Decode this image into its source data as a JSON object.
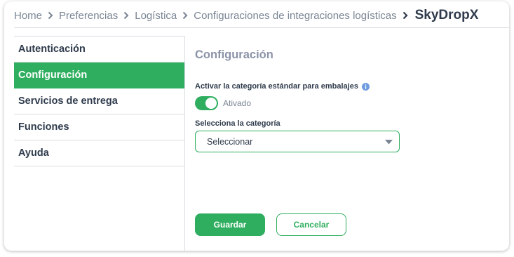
{
  "breadcrumb": {
    "items": [
      "Home",
      "Preferencias",
      "Logística",
      "Configuraciones de integraciones logísticas"
    ],
    "current": "SkyDropX"
  },
  "sidebar": {
    "items": [
      {
        "label": "Autenticación",
        "active": false
      },
      {
        "label": "Configuración",
        "active": true
      },
      {
        "label": "Servicios de entrega",
        "active": false
      },
      {
        "label": "Funciones",
        "active": false
      },
      {
        "label": "Ayuda",
        "active": false
      }
    ]
  },
  "main": {
    "title": "Configuración",
    "toggle_label": "Activar la categoría estándar para embalajes",
    "toggle_state_text": "Ativado",
    "toggle_on": true,
    "category_label": "Selecciona la categoría",
    "category_select_value": "Seleccionar"
  },
  "actions": {
    "save_label": "Guardar",
    "cancel_label": "Cancelar"
  },
  "icons": {
    "breadcrumb_separator": "chevron-right-icon",
    "info": "info-icon",
    "select_caret": "caret-down-icon"
  },
  "colors": {
    "accent": "#2fae5f",
    "text": "#2f3b4c",
    "muted": "#7a8594",
    "title": "#8b93a7",
    "info": "#6f9be0"
  }
}
